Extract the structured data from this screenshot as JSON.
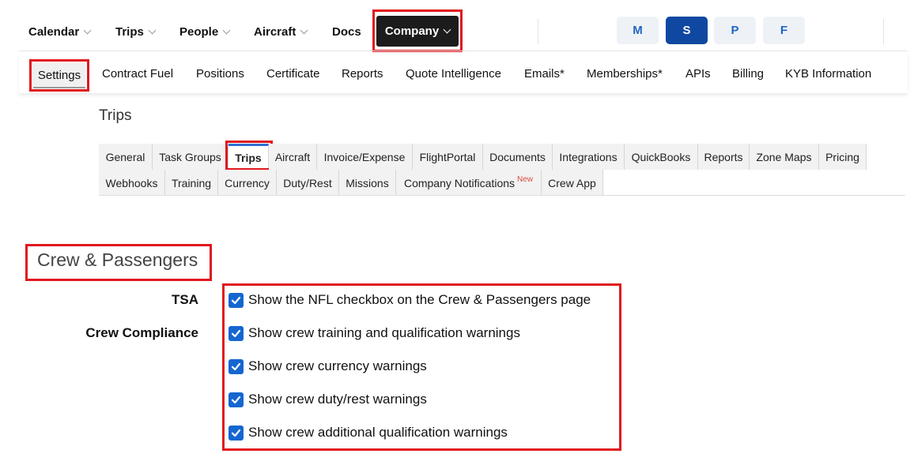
{
  "topnav": {
    "items": [
      {
        "label": "Calendar"
      },
      {
        "label": "Trips"
      },
      {
        "label": "People"
      },
      {
        "label": "Aircraft"
      },
      {
        "label": "Docs"
      }
    ],
    "company_label": "Company",
    "avatars": [
      "M",
      "S",
      "P",
      "F"
    ]
  },
  "subnav": {
    "items": [
      "Settings",
      "Contract Fuel",
      "Positions",
      "Certificate",
      "Reports",
      "Quote Intelligence",
      "Emails*",
      "Memberships*",
      "APIs",
      "Billing",
      "KYB Information"
    ]
  },
  "settings": {
    "section_title": "Trips",
    "tabs_row1": [
      "General",
      "Task Groups",
      "Trips",
      "Aircraft",
      "Invoice/Expense",
      "FlightPortal",
      "Documents",
      "Integrations",
      "QuickBooks",
      "Reports",
      "Zone Maps",
      "Pricing"
    ],
    "tabs_row2": [
      "Webhooks",
      "Training",
      "Currency",
      "Duty/Rest",
      "Missions",
      "Company Notifications",
      "Crew App"
    ],
    "new_badge": "New"
  },
  "crew_passengers": {
    "title": "Crew & Passengers",
    "tsa_label": "TSA",
    "compliance_label": "Crew Compliance",
    "options": [
      {
        "label": "Show the NFL checkbox on the Crew & Passengers page",
        "checked": true
      },
      {
        "label": "Show crew training and qualification warnings",
        "checked": true
      },
      {
        "label": "Show crew currency warnings",
        "checked": true
      },
      {
        "label": "Show crew duty/rest warnings",
        "checked": true
      },
      {
        "label": "Show crew additional qualification warnings",
        "checked": true
      }
    ]
  },
  "colors": {
    "highlight": "#e0181e",
    "checkbox": "#1566d1",
    "active_avatar": "#0e48a1",
    "company_bg": "#1c1c1c"
  }
}
